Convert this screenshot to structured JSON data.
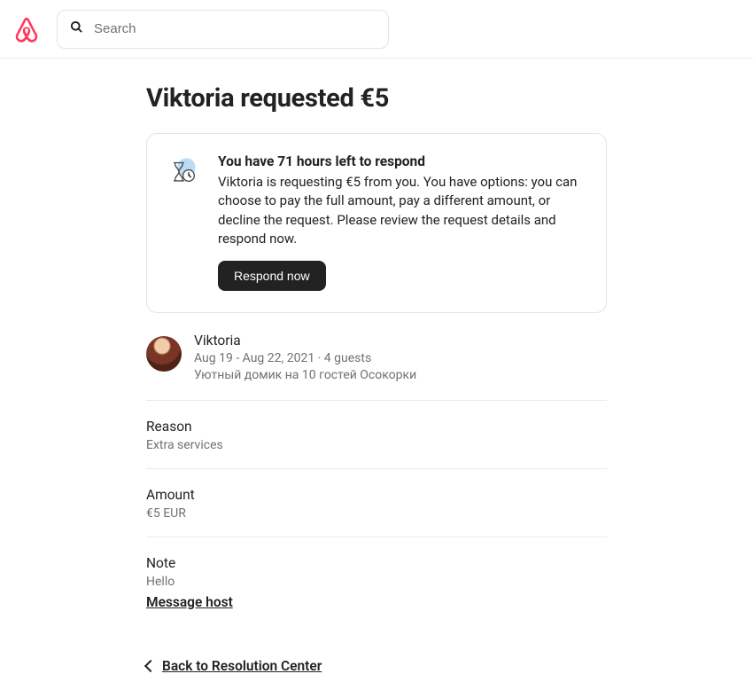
{
  "header": {
    "search_placeholder": "Search"
  },
  "title": "Viktoria requested €5",
  "alert": {
    "title": "You have 71 hours left to respond",
    "description": "Viktoria is requesting €5 from you. You have options: you can choose to pay the full amount, pay a different amount, or decline the request. Please review the request details and respond now.",
    "cta": "Respond now"
  },
  "requester": {
    "name": "Viktoria",
    "dates_guests": "Aug 19 - Aug 22, 2021 · 4 guests",
    "listing": "Уютный домик на 10 гостей Осокорки"
  },
  "sections": {
    "reason": {
      "label": "Reason",
      "value": "Extra services"
    },
    "amount": {
      "label": "Amount",
      "value": "€5 EUR"
    },
    "note": {
      "label": "Note",
      "value": "Hello"
    }
  },
  "links": {
    "message_host": "Message host",
    "back": "Back to Resolution Center"
  }
}
